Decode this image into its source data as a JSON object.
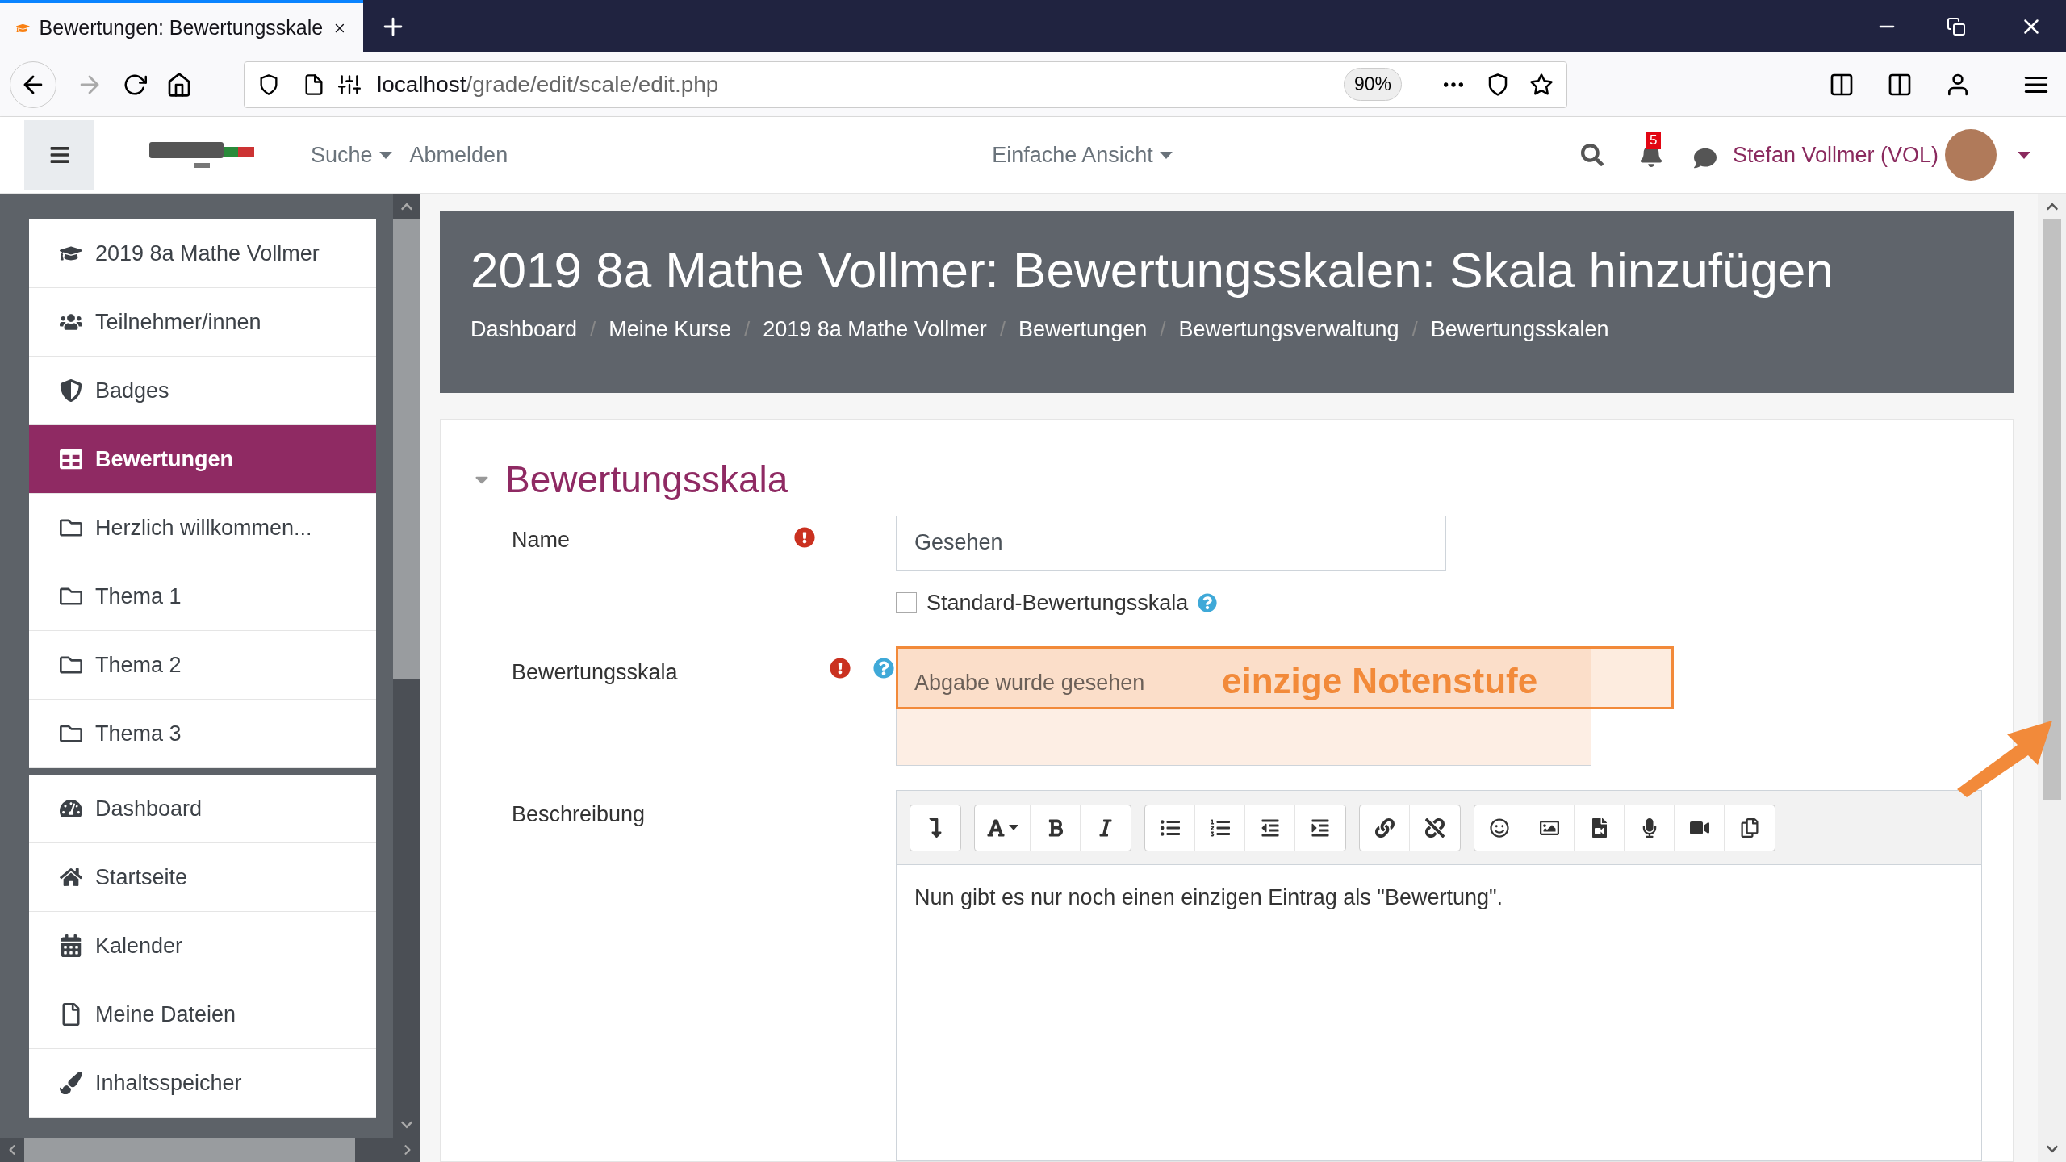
{
  "browser": {
    "tab_title": "Bewertungen: Bewertungsskale",
    "url_host": "localhost",
    "url_path": "/grade/edit/scale/edit.php",
    "zoom": "90%"
  },
  "navbar": {
    "links": [
      {
        "label": "Suche",
        "kind": "dropdown"
      },
      {
        "label": "Abmelden",
        "kind": "link"
      }
    ],
    "view": "Einfache Ansicht",
    "notifications": "5",
    "user": "Stefan Vollmer (VOL)"
  },
  "sidebar": {
    "groups": [
      [
        {
          "label": "2019 8a Mathe Vollmer",
          "kind": "course",
          "selected": false
        },
        {
          "label": "Teilnehmer/innen",
          "kind": "users",
          "selected": false
        },
        {
          "label": "Badges",
          "kind": "badge",
          "selected": false
        },
        {
          "label": "Bewertungen",
          "kind": "grades",
          "selected": true
        },
        {
          "label": "Herzlich willkommen...",
          "kind": "folder",
          "selected": false
        },
        {
          "label": "Thema 1",
          "kind": "folder",
          "selected": false
        },
        {
          "label": "Thema 2",
          "kind": "folder",
          "selected": false
        },
        {
          "label": "Thema 3",
          "kind": "folder",
          "selected": false
        }
      ],
      [
        {
          "label": "Dashboard",
          "kind": "dashboard",
          "selected": false
        },
        {
          "label": "Startseite",
          "kind": "home",
          "selected": false
        },
        {
          "label": "Kalender",
          "kind": "calendar",
          "selected": false
        },
        {
          "label": "Meine Dateien",
          "kind": "file",
          "selected": false
        },
        {
          "label": "Inhaltsspeicher",
          "kind": "brush",
          "selected": false
        }
      ]
    ]
  },
  "header": {
    "separator": "/",
    "title": "2019 8a Mathe Vollmer: Bewertungsskalen: Skala hinzufügen",
    "breadcrumbs": [
      "Dashboard",
      "Meine Kurse",
      "2019 8a Mathe Vollmer",
      "Bewertungen",
      "Bewertungsverwaltung",
      "Bewertungsskalen"
    ]
  },
  "form": {
    "section": "Bewertungsskala",
    "expanded": true,
    "name": {
      "label": "Name",
      "required": true,
      "value": "Gesehen"
    },
    "standard": {
      "label": "Standard-Bewertungsskala",
      "checked": false
    },
    "scale": {
      "label": "Bewertungsskala",
      "required": true,
      "value": "Abgabe wurde gesehen",
      "annotation": "einzige Notenstufe"
    },
    "description": {
      "label": "Beschreibung",
      "text": "Nun gibt es nur noch einen einzigen Eintrag als \"Bewertung\"."
    }
  }
}
